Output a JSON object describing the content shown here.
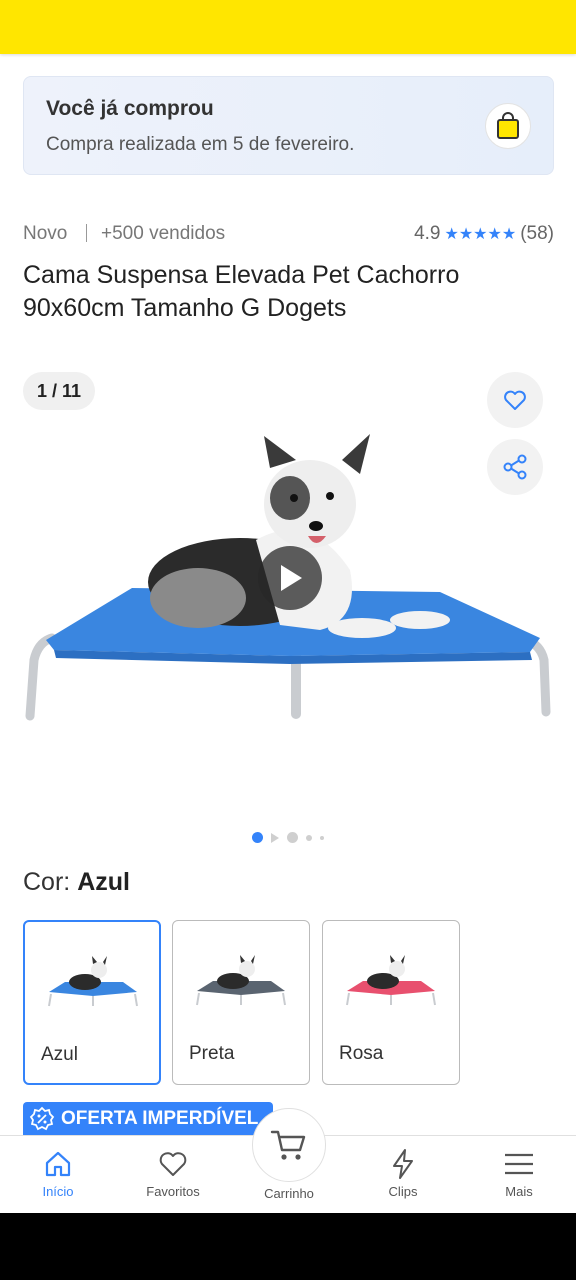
{
  "purchase_notice": {
    "title": "Você já comprou",
    "subtitle": "Compra realizada em 5 de fevereiro."
  },
  "product": {
    "condition": "Novo",
    "sold": "+500 vendidos",
    "rating": "4.9",
    "stars": "★★★★★",
    "reviews": "(58)",
    "title": "Cama Suspensa Elevada Pet Cachorro 90x60cm Tamanho G Dogets"
  },
  "gallery": {
    "counter": "1 / 11"
  },
  "color": {
    "label": "Cor: ",
    "selected": "Azul",
    "options": [
      {
        "label": "Azul",
        "bed_color": "#3a86e0"
      },
      {
        "label": "Preta",
        "bed_color": "#5a6470"
      },
      {
        "label": "Rosa",
        "bed_color": "#e8506e"
      }
    ]
  },
  "offer_badge": "OFERTA IMPERDÍVEL",
  "nav": {
    "home": "Início",
    "favorites": "Favoritos",
    "cart": "Carrinho",
    "clips": "Clips",
    "more": "Mais"
  },
  "colors": {
    "brand_yellow": "#ffe600",
    "accent_blue": "#3483fa"
  }
}
